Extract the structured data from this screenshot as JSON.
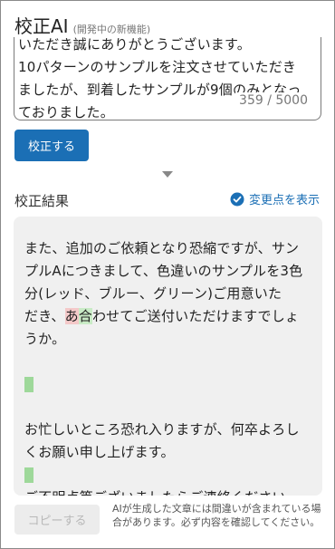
{
  "header": {
    "title": "校正AI",
    "subtitle": "(開発中の新機能)"
  },
  "input": {
    "lines": [
      "いただき誠にありがとうございます。",
      "10パターンのサンプルを注文させていただき",
      "ましたが、到着したサンプルが9個のみとなっ",
      "ておりました。"
    ],
    "counter": "359 / 5000"
  },
  "proofread_button": "校正する",
  "result": {
    "label": "校正結果",
    "show_changes": "変更点を表示",
    "p1_lines": [
      "また、追加のご依頼となり恐縮ですが、サン",
      "プルAにつきまして、色違いのサンプルを3色",
      "分(レッド、ブルー、グリーン)ご用意いた"
    ],
    "p1_line4_before": "だき、",
    "p1_del": "あ",
    "p1_ins": "合",
    "p1_line4_after": "わせてご送付いただけますでしょ",
    "p1_line5": "うか。",
    "p2_lines": [
      "お忙しいところ恐れ入りますが、何卒よろし",
      "くお願い申し上げます。"
    ],
    "p3": "ご不明点等ございましたらご連絡ください。"
  },
  "copy_button": "コピーする",
  "disclaimer": "AIが生成した文章には間違いが含まれている場合があります。必ず内容を確認してください。",
  "colors": {
    "accent": "#1b6fb5",
    "deleted": "#f4c9c9",
    "inserted": "#c9ebc6"
  }
}
